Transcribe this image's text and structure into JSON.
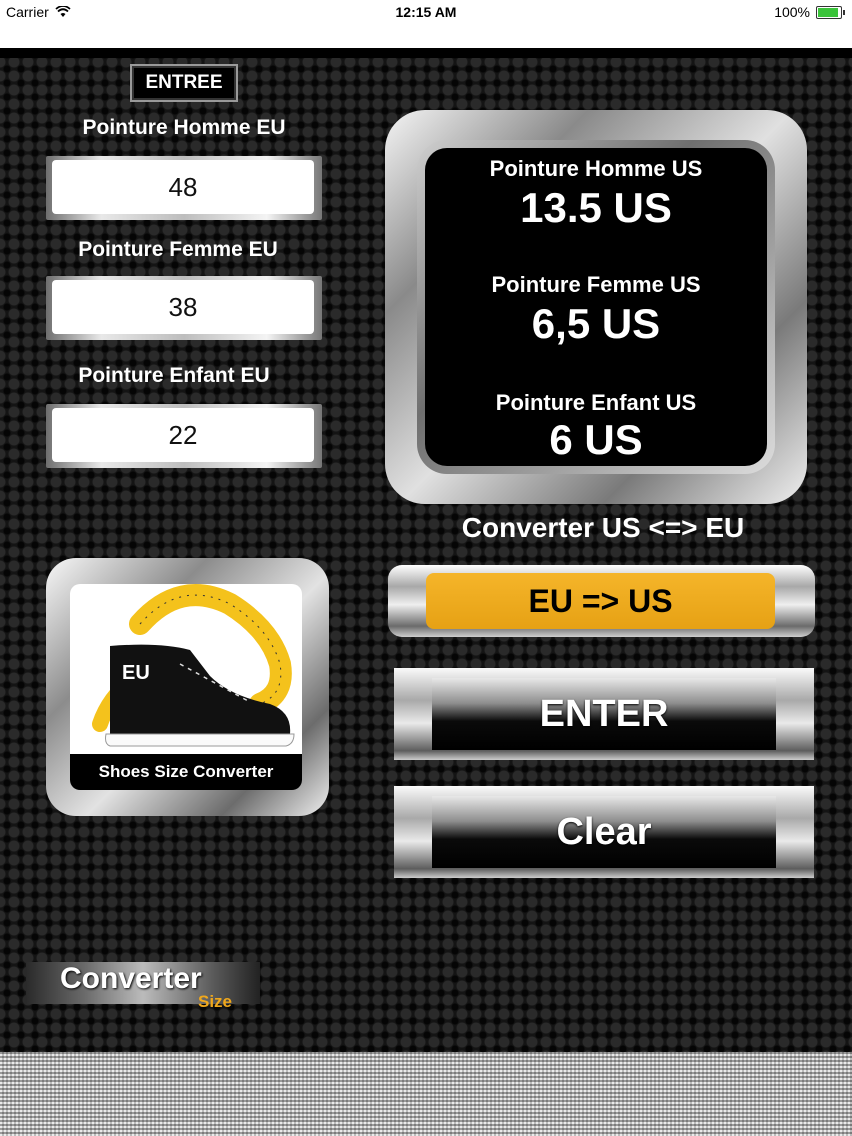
{
  "status_bar": {
    "carrier": "Carrier",
    "time": "12:15 AM",
    "battery": "100%",
    "battery_level": 1.0
  },
  "entree_label": "ENTREE",
  "inputs": [
    {
      "label": "Pointure Homme EU",
      "value": "48"
    },
    {
      "label": "Pointure Femme EU",
      "value": "38"
    },
    {
      "label": "Pointure Enfant EU",
      "value": "22"
    }
  ],
  "results": [
    {
      "label": "Pointure Homme US",
      "value": "13.5 US"
    },
    {
      "label": "Pointure Femme US",
      "value": "6,5 US"
    },
    {
      "label": "Pointure Enfant US",
      "value": "6 US"
    }
  ],
  "converter_label": "Converter US <=> EU",
  "mode_button": "EU => US",
  "enter_button": "ENTER",
  "clear_button": "Clear",
  "logo": {
    "badge": "EU",
    "caption": "Shoes Size Converter"
  },
  "brand": {
    "main": "Converter",
    "sub": "Size"
  },
  "colors": {
    "accent": "#E8A416",
    "background": "#141414"
  }
}
